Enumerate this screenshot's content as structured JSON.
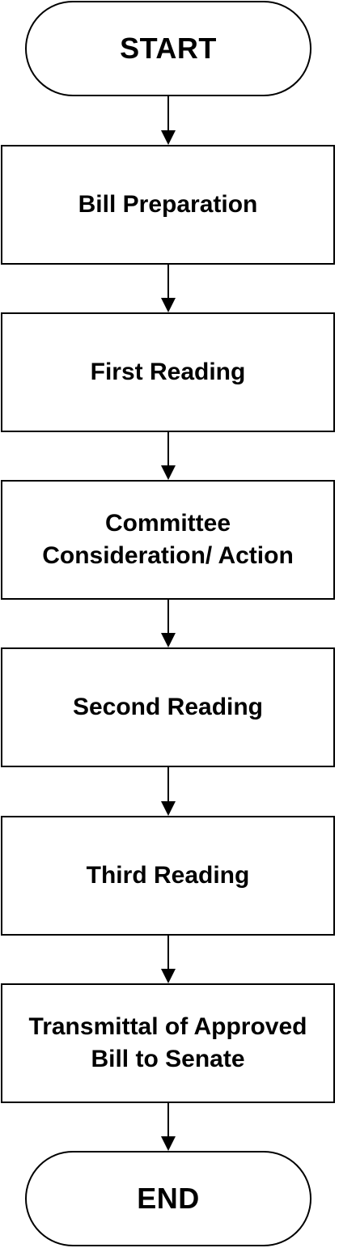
{
  "flowchart": {
    "start": "START",
    "steps": [
      "Bill Preparation",
      "First Reading",
      "Committee\nConsideration/ Action",
      "Second Reading",
      "Third Reading",
      "Transmittal of Approved\nBill to Senate"
    ],
    "end": "END"
  },
  "colors": {
    "stroke": "#000000",
    "fill": "#ffffff",
    "text": "#000000"
  }
}
